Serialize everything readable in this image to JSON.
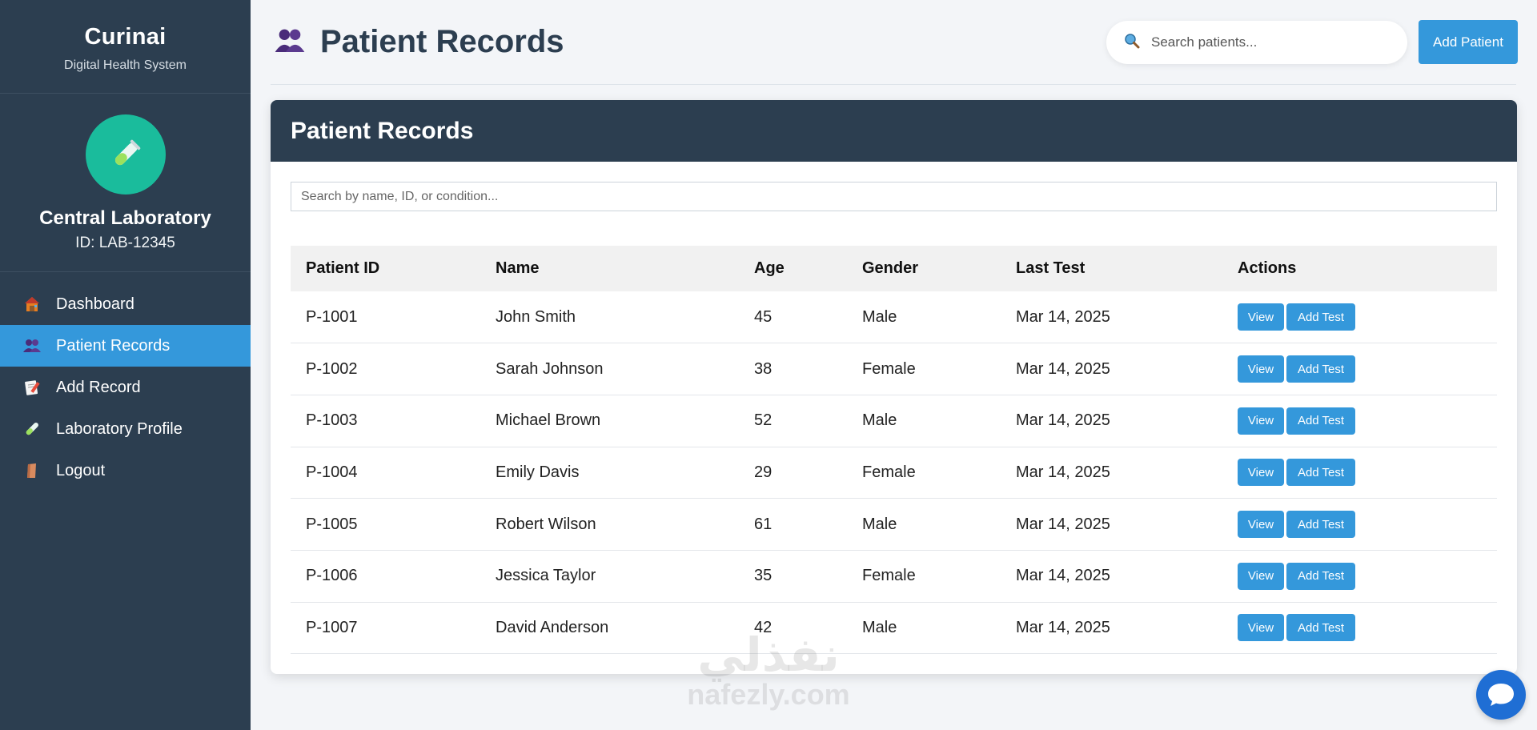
{
  "app": {
    "name": "Curinai",
    "subtitle": "Digital Health System"
  },
  "profile": {
    "name": "Central Laboratory",
    "id_text": "ID: LAB-12345",
    "avatar_icon": "test-tube-icon"
  },
  "nav": [
    {
      "label": "Dashboard",
      "icon": "house-icon",
      "active": false
    },
    {
      "label": "Patient Records",
      "icon": "people-icon",
      "active": true
    },
    {
      "label": "Add Record",
      "icon": "memo-icon",
      "active": false
    },
    {
      "label": "Laboratory Profile",
      "icon": "test-tube-icon",
      "active": false
    },
    {
      "label": "Logout",
      "icon": "door-icon",
      "active": false
    }
  ],
  "header": {
    "title": "Patient Records",
    "title_icon": "people-icon",
    "search_placeholder": "Search patients...",
    "add_button": "Add Patient"
  },
  "card": {
    "title": "Patient Records",
    "filter_placeholder": "Search by name, ID, or condition..."
  },
  "table": {
    "columns": [
      "Patient ID",
      "Name",
      "Age",
      "Gender",
      "Last Test",
      "Actions"
    ],
    "rows": [
      {
        "id": "P-1001",
        "name": "John Smith",
        "age": "45",
        "gender": "Male",
        "last_test": "Mar 14, 2025"
      },
      {
        "id": "P-1002",
        "name": "Sarah Johnson",
        "age": "38",
        "gender": "Female",
        "last_test": "Mar 14, 2025"
      },
      {
        "id": "P-1003",
        "name": "Michael Brown",
        "age": "52",
        "gender": "Male",
        "last_test": "Mar 14, 2025"
      },
      {
        "id": "P-1004",
        "name": "Emily Davis",
        "age": "29",
        "gender": "Female",
        "last_test": "Mar 14, 2025"
      },
      {
        "id": "P-1005",
        "name": "Robert Wilson",
        "age": "61",
        "gender": "Male",
        "last_test": "Mar 14, 2025"
      },
      {
        "id": "P-1006",
        "name": "Jessica Taylor",
        "age": "35",
        "gender": "Female",
        "last_test": "Mar 14, 2025"
      },
      {
        "id": "P-1007",
        "name": "David Anderson",
        "age": "42",
        "gender": "Male",
        "last_test": "Mar 14, 2025"
      }
    ],
    "view_label": "View",
    "add_test_label": "Add Test"
  },
  "watermark": {
    "arabic": "نفذلي",
    "latin": "nafezly.com"
  },
  "colors": {
    "sidebar": "#2c3e50",
    "accent": "#3498db",
    "avatar": "#1abc9c",
    "chat": "#1f6ed4"
  }
}
